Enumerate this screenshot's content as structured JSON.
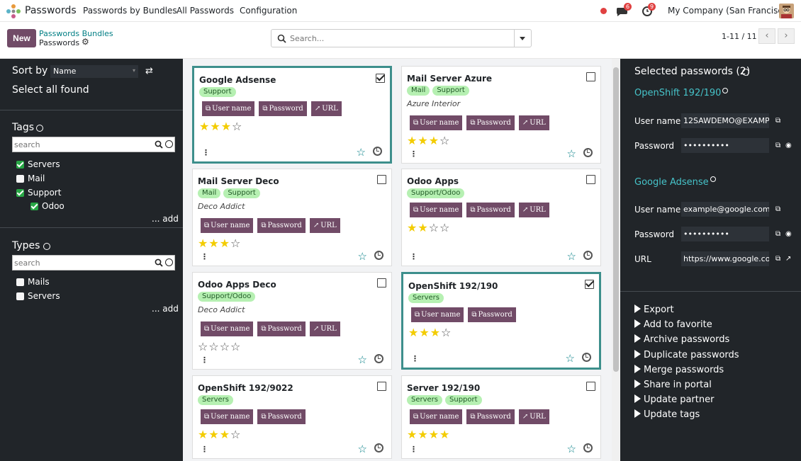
{
  "topbar": {
    "app_name": "Passwords",
    "menus": [
      "Passwords by Bundles",
      "All Passwords",
      "Configuration"
    ],
    "messages_count": "6",
    "activities_count": "9",
    "company": "My Company (San Francisco)",
    "colors": {
      "status_dot": "#e04141"
    }
  },
  "control": {
    "new_label": "New",
    "breadcrumb_parent": "Passwords Bundles",
    "breadcrumb_current": "Passwords",
    "search_placeholder": "Search...",
    "pager": "1-11 / 11"
  },
  "left": {
    "sort_by_label": "Sort by",
    "sort_value": "Name",
    "select_all_label": "Select all found",
    "tags_title": "Tags",
    "tags_search_placeholder": "search",
    "tags": [
      {
        "label": "Servers",
        "checked": true
      },
      {
        "label": "Mail",
        "checked": false
      },
      {
        "label": "Support",
        "checked": true
      },
      {
        "label": "Odoo",
        "checked": true
      }
    ],
    "tags_add": "... add",
    "types_title": "Types",
    "types_search_placeholder": "search",
    "types": [
      {
        "label": "Mails",
        "checked": false
      },
      {
        "label": "Servers",
        "checked": false
      }
    ],
    "types_add": "... add"
  },
  "card_buttons": {
    "username": "User name",
    "password": "Password",
    "url": "URL"
  },
  "cards": [
    {
      "title": "Google Adsense",
      "tags": [
        "Support"
      ],
      "partner": "",
      "selected": true,
      "buttons": [
        "username",
        "password",
        "url"
      ],
      "stars": 3
    },
    {
      "title": "Mail Server Azure",
      "tags": [
        "Mail",
        "Support"
      ],
      "partner": "Azure Interior",
      "selected": false,
      "buttons": [
        "username",
        "password",
        "url"
      ],
      "stars": 3
    },
    {
      "title": "Mail Server Deco",
      "tags": [
        "Mail",
        "Support"
      ],
      "partner": "Deco Addict",
      "selected": false,
      "buttons": [
        "username",
        "password",
        "url"
      ],
      "stars": 3
    },
    {
      "title": "Odoo Apps",
      "tags": [
        "Support/Odoo"
      ],
      "partner": "",
      "selected": false,
      "buttons": [
        "username",
        "password",
        "url"
      ],
      "stars": 2
    },
    {
      "title": "Odoo Apps Deco",
      "tags": [
        "Support/Odoo"
      ],
      "partner": "Deco Addict",
      "selected": false,
      "buttons": [
        "username",
        "password",
        "url"
      ],
      "stars": 0
    },
    {
      "title": "OpenShift 192/190",
      "tags": [
        "Servers"
      ],
      "partner": "",
      "selected": true,
      "buttons": [
        "username",
        "password"
      ],
      "stars": 3
    },
    {
      "title": "OpenShift 192/9022",
      "tags": [
        "Servers"
      ],
      "partner": "",
      "selected": false,
      "buttons": [
        "username",
        "password"
      ],
      "stars": 3
    },
    {
      "title": "Server 192/190",
      "tags": [
        "Servers",
        "Support"
      ],
      "partner": "",
      "selected": false,
      "buttons": [
        "username",
        "password",
        "url"
      ],
      "stars": 4
    }
  ],
  "right": {
    "selected_title": "Selected passwords (2)",
    "items": [
      {
        "name": "OpenShift 192/190",
        "fields": [
          {
            "label": "User name",
            "value": "12SAWDEMO@EXAMP"
          },
          {
            "label": "Password",
            "value": "••••••••••"
          }
        ]
      },
      {
        "name": "Google Adsense",
        "fields": [
          {
            "label": "User name",
            "value": "example@google.com"
          },
          {
            "label": "Password",
            "value": "••••••••••"
          },
          {
            "label": "URL",
            "value": "https://www.google.co"
          }
        ]
      }
    ],
    "actions": [
      "Export",
      "Add to favorite",
      "Archive passwords",
      "Duplicate passwords",
      "Merge passwords",
      "Share in portal",
      "Update partner",
      "Update tags"
    ]
  }
}
